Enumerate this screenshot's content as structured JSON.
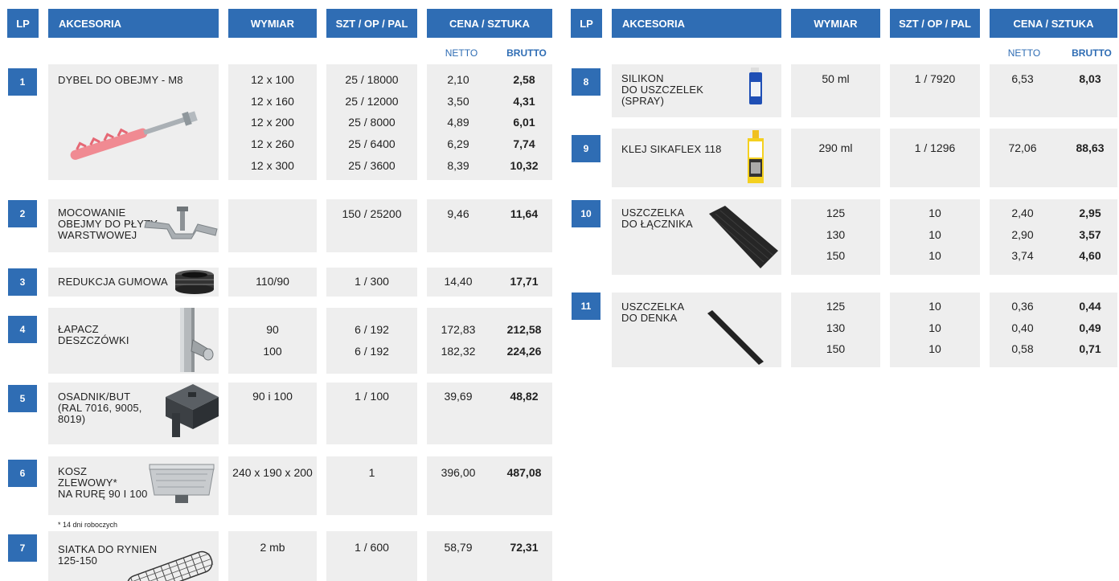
{
  "headers": {
    "lp": "LP",
    "akcesoria": "AKCESORIA",
    "wymiar": "WYMIAR",
    "szt": "SZT / OP / PAL",
    "cena": "CENA / SZTUKA",
    "netto": "NETTO",
    "brutto": "BRUTTO"
  },
  "products": [
    {
      "no": "1",
      "name": "DYBEL DO OBEJMY - M8",
      "wymiar": [
        "12 x 100",
        "12 x 160",
        "12 x 200",
        "12 x 260",
        "12 x 300"
      ],
      "szt": [
        "25 / 18000",
        "25 / 12000",
        "25 / 8000",
        "25 / 6400",
        "25 / 3600"
      ],
      "netto": [
        "2,10",
        "3,50",
        "4,89",
        "6,29",
        "8,39"
      ],
      "brutto": [
        "2,58",
        "4,31",
        "6,01",
        "7,74",
        "10,32"
      ],
      "icon": "wall-plug-icon"
    },
    {
      "no": "2",
      "name": "MOCOWANIE\nOBEJMY DO PŁYTY\nWARSTWOWEJ",
      "wymiar": [],
      "szt": [
        "150 / 25200"
      ],
      "netto": [
        "9,46"
      ],
      "brutto": [
        "11,64"
      ],
      "icon": "bracket-icon"
    },
    {
      "no": "3",
      "name": "REDUKCJA GUMOWA",
      "wymiar": [
        "110/90"
      ],
      "szt": [
        "1 / 300"
      ],
      "netto": [
        "14,40"
      ],
      "brutto": [
        "17,71"
      ],
      "icon": "rubber-reducer-icon"
    },
    {
      "no": "4",
      "name": "ŁAPACZ\nDESZCZÓWKI",
      "wymiar": [
        "90",
        "100"
      ],
      "szt": [
        "6 / 192",
        "6 / 192"
      ],
      "netto": [
        "172,83",
        "182,32"
      ],
      "brutto": [
        "212,58",
        "224,26"
      ],
      "icon": "rainwater-collector-icon"
    },
    {
      "no": "5",
      "name": "OSADNIK/BUT\n(RAL 7016, 9005,\n8019)",
      "wymiar": [
        "90 i 100"
      ],
      "szt": [
        "1 / 100"
      ],
      "netto": [
        "39,69"
      ],
      "brutto": [
        "48,82"
      ],
      "icon": "settler-icon"
    },
    {
      "no": "6",
      "name": "KOSZ\nZLEWOWY*\nNA RURĘ 90 i 100",
      "wymiar": [
        "240 x 190 x 200"
      ],
      "szt": [
        "1"
      ],
      "netto": [
        "396,00"
      ],
      "brutto": [
        "487,08"
      ],
      "icon": "sink-basket-icon"
    },
    {
      "no": "7",
      "name": "SIATKA DO RYNIEN\n125-150",
      "wymiar": [
        "2 mb"
      ],
      "szt": [
        "1 / 600"
      ],
      "netto": [
        "58,79"
      ],
      "brutto": [
        "72,31"
      ],
      "icon": "gutter-mesh-icon"
    },
    {
      "no": "8",
      "name": "SILIKON\nDO USZCZELEK\n(SPRAY)",
      "wymiar": [
        "50 ml"
      ],
      "szt": [
        "1 / 7920"
      ],
      "netto": [
        "6,53"
      ],
      "brutto": [
        "8,03"
      ],
      "icon": "spray-can-icon"
    },
    {
      "no": "9",
      "name": "KLEJ SIKAFLEX 118",
      "wymiar": [
        "290 ml"
      ],
      "szt": [
        "1 / 1296"
      ],
      "netto": [
        "72,06"
      ],
      "brutto": [
        "88,63"
      ],
      "icon": "sealant-cartridge-icon"
    },
    {
      "no": "10",
      "name": "USZCZELKA\nDO ŁĄCZNIKA",
      "wymiar": [
        "125",
        "130",
        "150"
      ],
      "szt": [
        "10",
        "10",
        "10"
      ],
      "netto": [
        "2,40",
        "2,90",
        "3,74"
      ],
      "brutto": [
        "2,95",
        "3,57",
        "4,60"
      ],
      "icon": "gasket-mat-icon"
    },
    {
      "no": "11",
      "name": "USZCZELKA\nDO DENKA",
      "wymiar": [
        "125",
        "130",
        "150"
      ],
      "szt": [
        "10",
        "10",
        "10"
      ],
      "netto": [
        "0,36",
        "0,40",
        "0,58"
      ],
      "brutto": [
        "0,44",
        "0,49",
        "0,71"
      ],
      "icon": "gasket-strip-icon"
    }
  ],
  "footnote": "* 14 dni roboczych",
  "colors": {
    "accent": "#2f6db4",
    "cell_bg": "#eeeeee"
  }
}
